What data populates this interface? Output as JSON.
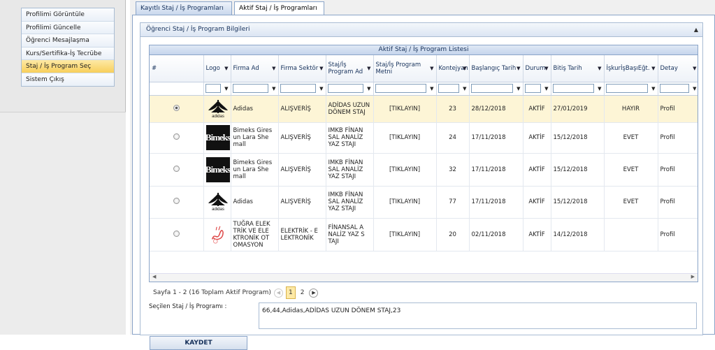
{
  "menu": {
    "items": [
      "Profilimi Görüntüle",
      "Profilimi Güncelle",
      "Öğrenci Mesajlaşma",
      "Kurs/Sertifika-İş Tecrübe",
      "Staj / İş Program Seç",
      "Sistem Çıkış"
    ],
    "selected_index": 4
  },
  "tabs": [
    "Kayıtlı Staj / İş Programları",
    "Aktif Staj / İş Programları"
  ],
  "active_tab": 1,
  "panel": {
    "title": "Öğrenci Staj / İş Program Bilgileri",
    "collapse_icon": "chevron-up-icon"
  },
  "grid": {
    "title": "Aktif Staj / İş Program Listesi",
    "columns": [
      "#",
      "Logo",
      "Firma Ad",
      "Firma Sektör",
      "Staj/İş Program Ad",
      "Staj/İş Program Metni",
      "Kontejyan",
      "Başlangıç Tarih",
      "Durum",
      "Bitiş Tarih",
      "İşkurİşBaşıEğt.",
      "Detay"
    ],
    "rows": [
      {
        "logo": "adidas",
        "firma": "Adidas",
        "sektor": "ALIŞVERİŞ",
        "program": "ADİDAS UZUN DÖNEM STAJ",
        "metin": "[TIKLAYIN]",
        "kontenjan": "23",
        "baslangic": "28/12/2018",
        "durum": "AKTİF",
        "bitis": "27/01/2019",
        "iskur": "HAYIR",
        "detay": "Profil",
        "selected": true
      },
      {
        "logo": "bimeks",
        "firma": "Bimeks Gires un Lara She mall",
        "sektor": "ALIŞVERİŞ",
        "program": "IMKB FİNAN SAL ANALİZ YAZ STAJI",
        "metin": "[TIKLAYIN]",
        "kontenjan": "24",
        "baslangic": "17/11/2018",
        "durum": "AKTİF",
        "bitis": "15/12/2018",
        "iskur": "EVET",
        "detay": "Profil",
        "selected": false
      },
      {
        "logo": "bimeks",
        "firma": "Bimeks Gires un Lara She mall",
        "sektor": "ALIŞVERİŞ",
        "program": "IMKB FİNAN SAL ANALİZ YAZ STAJI",
        "metin": "[TIKLAYIN]",
        "kontenjan": "32",
        "baslangic": "17/11/2018",
        "durum": "AKTİF",
        "bitis": "15/12/2018",
        "iskur": "EVET",
        "detay": "Profil",
        "selected": false
      },
      {
        "logo": "adidas",
        "firma": "Adidas",
        "sektor": "ALIŞVERİŞ",
        "program": "IMKB FİNAN SAL ANALİZ YAZ STAJI",
        "metin": "[TIKLAYIN]",
        "kontenjan": "77",
        "baslangic": "17/11/2018",
        "durum": "AKTİF",
        "bitis": "15/12/2018",
        "iskur": "EVET",
        "detay": "Profil",
        "selected": false
      },
      {
        "logo": "tugra",
        "firma": "TUĞRA ELEK TRİK VE ELE KTRONİK OT OMASYON",
        "sektor": "ELEKTRİK - E LEKTRONİK",
        "program": "FİNANSAL A NALİZ YAZ S TAJI",
        "metin": "[TIKLAYIN]",
        "kontenjan": "20",
        "baslangic": "02/11/2018",
        "durum": "AKTİF",
        "bitis": "14/12/2018",
        "iskur": "",
        "detay": "Profil",
        "selected": false
      }
    ],
    "bimeks_logo_text": "Bimeks",
    "adidas_logo_text": "adidas"
  },
  "pager": {
    "summary": "Sayfa 1 - 2 (16 Toplam Aktif Program)",
    "pages": [
      "1",
      "2"
    ],
    "current": "1"
  },
  "selection": {
    "label": "Seçilen Staj / İş Programı :",
    "value": "66,44,Adidas,ADİDAS UZUN DÖNEM STAJ,23"
  },
  "save_label": "KAYDET"
}
